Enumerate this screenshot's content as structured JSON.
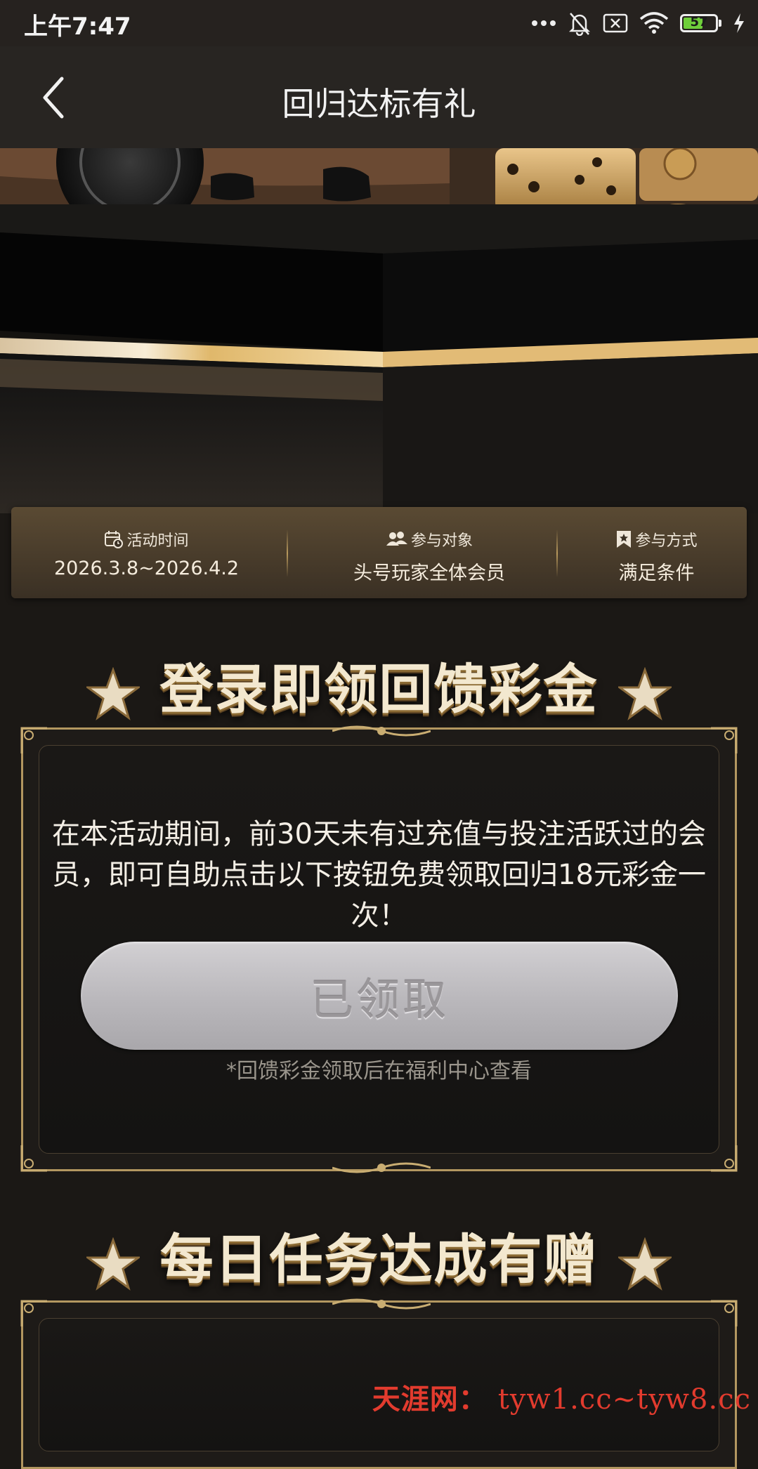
{
  "status_bar": {
    "time": "上午7:47",
    "battery_level": "57",
    "icons": [
      "more-dots-icon",
      "bell-off-icon",
      "sim-x-icon",
      "wifi-icon",
      "battery-icon",
      "charging-bolt-icon"
    ]
  },
  "header": {
    "title": "回归达标有礼",
    "back_icon": "chevron-left-icon"
  },
  "info_bar": {
    "items": [
      {
        "label": "活动时间",
        "value": "2026.3.8~2026.4.2",
        "icon": "calendar-clock-icon"
      },
      {
        "label": "参与对象",
        "value": "头号玩家全体会员",
        "icon": "users-icon"
      },
      {
        "label": "参与方式",
        "value": "满足条件",
        "icon": "bookmark-star-icon"
      }
    ]
  },
  "section1": {
    "title": "登录即领回馈彩金",
    "description": "在本活动期间，前30天未有过充值与投注活跃过的会员，即可自助点击以下按钮免费领取回归18元彩金一次！",
    "button_label": "已领取",
    "note": "*回馈彩金领取后在福利中心查看"
  },
  "section2": {
    "title": "每日任务达成有赠"
  },
  "watermark": {
    "brand": "天涯网",
    "sep": "：",
    "domains": "tyw1.cc~tyw8.cc"
  },
  "colors": {
    "gold": "#b39760",
    "background": "#1b1815",
    "watermark_red": "#e23b2e"
  }
}
